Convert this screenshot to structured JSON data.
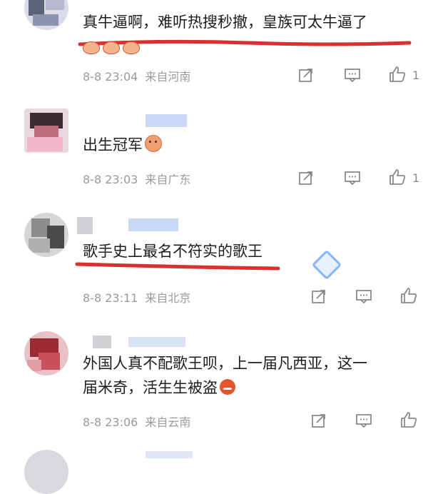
{
  "comments": [
    {
      "text": "真牛逼啊，难听热搜秒撤，皇族可太牛逼了",
      "date": "8-8 23:04",
      "location": "来自河南",
      "likes": "1"
    },
    {
      "text": "出生冠军",
      "date": "8-8 23:03",
      "location": "来自广东",
      "likes": "1"
    },
    {
      "text": "歌手史上最名不符实的歌王",
      "date": "8-8 23:11",
      "location": "来自北京",
      "likes": ""
    },
    {
      "text_line1": "外国人真不配歌王呗，上一届凡西亚，这一",
      "text_line2": "届米奇，活生生被盗",
      "date": "8-8 23:06",
      "location": "来自云南",
      "likes": ""
    }
  ],
  "icons": {
    "share": "share-icon",
    "comment": "comment-icon",
    "like": "thumbs-up-icon",
    "emoji_laugh": "laugh-emoji-icon",
    "emoji_crab": "crab-emoji-icon",
    "emoji_angry": "angry-emoji-icon",
    "badge": "diamond-badge-icon"
  },
  "colors": {
    "underline": "#d93030",
    "meta": "#9a9a9a",
    "text": "#1c1c1c"
  }
}
